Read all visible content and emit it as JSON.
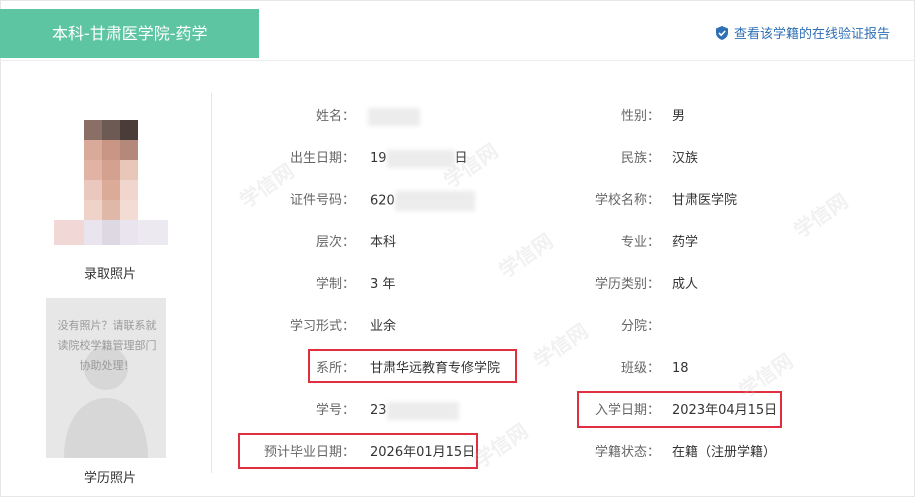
{
  "header": {
    "title": "本科-甘肃医学院-药学",
    "verify_link": "查看该学籍的在线验证报告"
  },
  "photos": {
    "admission_caption": "录取照片",
    "degree_caption": "学历照片",
    "no_photo_text": "没有照片？请联系就读院校学籍管理部门协助处理！"
  },
  "left_fields": [
    {
      "label": "姓名：",
      "value": ""
    },
    {
      "label": "出生日期：",
      "value_prefix": "19",
      "value_suffix": "日"
    },
    {
      "label": "证件号码：",
      "value_prefix": "620",
      "value_suffix": ""
    },
    {
      "label": "层次：",
      "value": "本科"
    },
    {
      "label": "学制：",
      "value": "3 年"
    },
    {
      "label": "学习形式：",
      "value": "业余"
    },
    {
      "label": "系所：",
      "value": "甘肃华远教育专修学院"
    },
    {
      "label": "学号：",
      "value_prefix": "23",
      "value_suffix": ""
    },
    {
      "label": "预计毕业日期：",
      "value": "2026年01月15日"
    }
  ],
  "right_fields": [
    {
      "label": "性别：",
      "value": "男"
    },
    {
      "label": "民族：",
      "value": "汉族"
    },
    {
      "label": "学校名称：",
      "value": "甘肃医学院"
    },
    {
      "label": "专业：",
      "value": "药学"
    },
    {
      "label": "学历类别：",
      "value": "成人"
    },
    {
      "label": "分院：",
      "value": ""
    },
    {
      "label": "班级：",
      "value": "18"
    },
    {
      "label": "入学日期：",
      "value": "2023年04月15日"
    },
    {
      "label": "学籍状态：",
      "value": "在籍（注册学籍）"
    }
  ],
  "watermark_text": "学信网",
  "colors": {
    "banner": "#5dc5a1",
    "link": "#2f6fb4",
    "highlight": "#e03040"
  }
}
